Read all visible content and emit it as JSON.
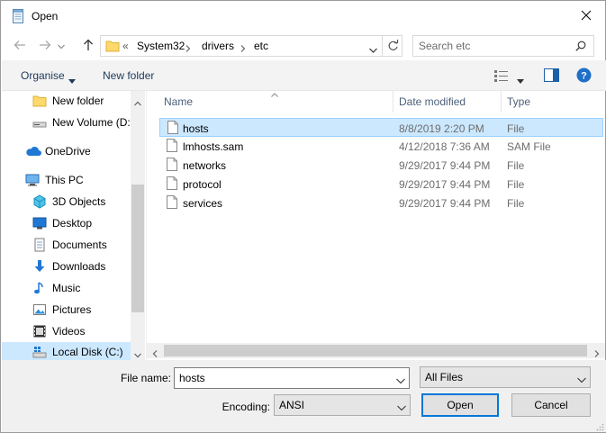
{
  "window": {
    "title": "Open"
  },
  "address": {
    "overflow": "«",
    "crumbs": [
      "System32",
      "drivers",
      "etc"
    ]
  },
  "search": {
    "placeholder": "Search etc"
  },
  "toolbar": {
    "organise": "Organise",
    "new_folder": "New folder"
  },
  "sidebar": {
    "items": [
      {
        "label": "New folder",
        "icon": "folder-icon"
      },
      {
        "label": "New Volume (D:)",
        "icon": "drive-icon"
      },
      {
        "label": "OneDrive",
        "icon": "onedrive-icon"
      },
      {
        "label": "This PC",
        "icon": "this-pc-icon"
      },
      {
        "label": "3D Objects",
        "icon": "3d-objects-icon"
      },
      {
        "label": "Desktop",
        "icon": "desktop-icon"
      },
      {
        "label": "Documents",
        "icon": "documents-icon"
      },
      {
        "label": "Downloads",
        "icon": "downloads-icon"
      },
      {
        "label": "Music",
        "icon": "music-icon"
      },
      {
        "label": "Pictures",
        "icon": "pictures-icon"
      },
      {
        "label": "Videos",
        "icon": "videos-icon"
      },
      {
        "label": "Local Disk (C:)",
        "icon": "local-disk-icon"
      }
    ]
  },
  "columns": {
    "name": "Name",
    "date": "Date modified",
    "type": "Type"
  },
  "files": [
    {
      "name": "hosts",
      "date": "8/8/2019 2:20 PM",
      "type": "File"
    },
    {
      "name": "lmhosts.sam",
      "date": "4/12/2018 7:36 AM",
      "type": "SAM File"
    },
    {
      "name": "networks",
      "date": "9/29/2017 9:44 PM",
      "type": "File"
    },
    {
      "name": "protocol",
      "date": "9/29/2017 9:44 PM",
      "type": "File"
    },
    {
      "name": "services",
      "date": "9/29/2017 9:44 PM",
      "type": "File"
    }
  ],
  "footer": {
    "filename_label": "File name:",
    "filename_value": "hosts",
    "filter_value": "All Files",
    "encoding_label": "Encoding:",
    "encoding_value": "ANSI",
    "open_label": "Open",
    "cancel_label": "Cancel"
  },
  "colors": {
    "selection": "#cce8ff",
    "accent": "#0078d7",
    "help": "#1e6fc8"
  }
}
